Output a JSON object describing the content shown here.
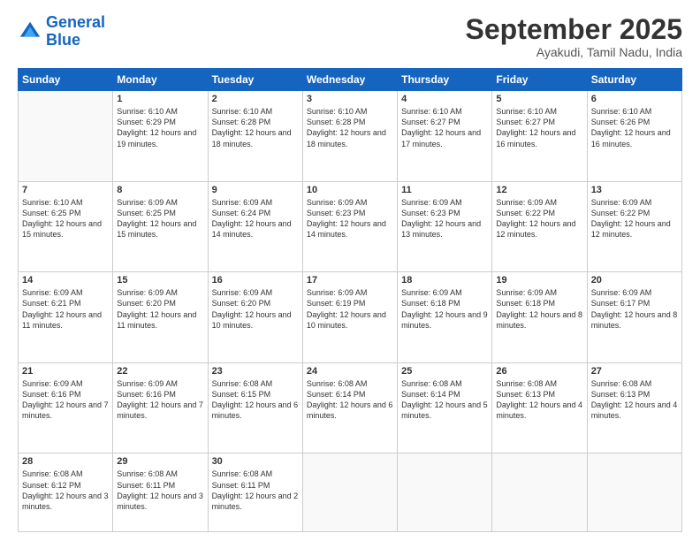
{
  "logo": {
    "line1": "General",
    "line2": "Blue"
  },
  "title": "September 2025",
  "location": "Ayakudi, Tamil Nadu, India",
  "days_header": [
    "Sunday",
    "Monday",
    "Tuesday",
    "Wednesday",
    "Thursday",
    "Friday",
    "Saturday"
  ],
  "weeks": [
    [
      {
        "num": "",
        "sunrise": "",
        "sunset": "",
        "daylight": ""
      },
      {
        "num": "1",
        "sunrise": "Sunrise: 6:10 AM",
        "sunset": "Sunset: 6:29 PM",
        "daylight": "Daylight: 12 hours and 19 minutes."
      },
      {
        "num": "2",
        "sunrise": "Sunrise: 6:10 AM",
        "sunset": "Sunset: 6:28 PM",
        "daylight": "Daylight: 12 hours and 18 minutes."
      },
      {
        "num": "3",
        "sunrise": "Sunrise: 6:10 AM",
        "sunset": "Sunset: 6:28 PM",
        "daylight": "Daylight: 12 hours and 18 minutes."
      },
      {
        "num": "4",
        "sunrise": "Sunrise: 6:10 AM",
        "sunset": "Sunset: 6:27 PM",
        "daylight": "Daylight: 12 hours and 17 minutes."
      },
      {
        "num": "5",
        "sunrise": "Sunrise: 6:10 AM",
        "sunset": "Sunset: 6:27 PM",
        "daylight": "Daylight: 12 hours and 16 minutes."
      },
      {
        "num": "6",
        "sunrise": "Sunrise: 6:10 AM",
        "sunset": "Sunset: 6:26 PM",
        "daylight": "Daylight: 12 hours and 16 minutes."
      }
    ],
    [
      {
        "num": "7",
        "sunrise": "Sunrise: 6:10 AM",
        "sunset": "Sunset: 6:25 PM",
        "daylight": "Daylight: 12 hours and 15 minutes."
      },
      {
        "num": "8",
        "sunrise": "Sunrise: 6:09 AM",
        "sunset": "Sunset: 6:25 PM",
        "daylight": "Daylight: 12 hours and 15 minutes."
      },
      {
        "num": "9",
        "sunrise": "Sunrise: 6:09 AM",
        "sunset": "Sunset: 6:24 PM",
        "daylight": "Daylight: 12 hours and 14 minutes."
      },
      {
        "num": "10",
        "sunrise": "Sunrise: 6:09 AM",
        "sunset": "Sunset: 6:23 PM",
        "daylight": "Daylight: 12 hours and 14 minutes."
      },
      {
        "num": "11",
        "sunrise": "Sunrise: 6:09 AM",
        "sunset": "Sunset: 6:23 PM",
        "daylight": "Daylight: 12 hours and 13 minutes."
      },
      {
        "num": "12",
        "sunrise": "Sunrise: 6:09 AM",
        "sunset": "Sunset: 6:22 PM",
        "daylight": "Daylight: 12 hours and 12 minutes."
      },
      {
        "num": "13",
        "sunrise": "Sunrise: 6:09 AM",
        "sunset": "Sunset: 6:22 PM",
        "daylight": "Daylight: 12 hours and 12 minutes."
      }
    ],
    [
      {
        "num": "14",
        "sunrise": "Sunrise: 6:09 AM",
        "sunset": "Sunset: 6:21 PM",
        "daylight": "Daylight: 12 hours and 11 minutes."
      },
      {
        "num": "15",
        "sunrise": "Sunrise: 6:09 AM",
        "sunset": "Sunset: 6:20 PM",
        "daylight": "Daylight: 12 hours and 11 minutes."
      },
      {
        "num": "16",
        "sunrise": "Sunrise: 6:09 AM",
        "sunset": "Sunset: 6:20 PM",
        "daylight": "Daylight: 12 hours and 10 minutes."
      },
      {
        "num": "17",
        "sunrise": "Sunrise: 6:09 AM",
        "sunset": "Sunset: 6:19 PM",
        "daylight": "Daylight: 12 hours and 10 minutes."
      },
      {
        "num": "18",
        "sunrise": "Sunrise: 6:09 AM",
        "sunset": "Sunset: 6:18 PM",
        "daylight": "Daylight: 12 hours and 9 minutes."
      },
      {
        "num": "19",
        "sunrise": "Sunrise: 6:09 AM",
        "sunset": "Sunset: 6:18 PM",
        "daylight": "Daylight: 12 hours and 8 minutes."
      },
      {
        "num": "20",
        "sunrise": "Sunrise: 6:09 AM",
        "sunset": "Sunset: 6:17 PM",
        "daylight": "Daylight: 12 hours and 8 minutes."
      }
    ],
    [
      {
        "num": "21",
        "sunrise": "Sunrise: 6:09 AM",
        "sunset": "Sunset: 6:16 PM",
        "daylight": "Daylight: 12 hours and 7 minutes."
      },
      {
        "num": "22",
        "sunrise": "Sunrise: 6:09 AM",
        "sunset": "Sunset: 6:16 PM",
        "daylight": "Daylight: 12 hours and 7 minutes."
      },
      {
        "num": "23",
        "sunrise": "Sunrise: 6:08 AM",
        "sunset": "Sunset: 6:15 PM",
        "daylight": "Daylight: 12 hours and 6 minutes."
      },
      {
        "num": "24",
        "sunrise": "Sunrise: 6:08 AM",
        "sunset": "Sunset: 6:14 PM",
        "daylight": "Daylight: 12 hours and 6 minutes."
      },
      {
        "num": "25",
        "sunrise": "Sunrise: 6:08 AM",
        "sunset": "Sunset: 6:14 PM",
        "daylight": "Daylight: 12 hours and 5 minutes."
      },
      {
        "num": "26",
        "sunrise": "Sunrise: 6:08 AM",
        "sunset": "Sunset: 6:13 PM",
        "daylight": "Daylight: 12 hours and 4 minutes."
      },
      {
        "num": "27",
        "sunrise": "Sunrise: 6:08 AM",
        "sunset": "Sunset: 6:13 PM",
        "daylight": "Daylight: 12 hours and 4 minutes."
      }
    ],
    [
      {
        "num": "28",
        "sunrise": "Sunrise: 6:08 AM",
        "sunset": "Sunset: 6:12 PM",
        "daylight": "Daylight: 12 hours and 3 minutes."
      },
      {
        "num": "29",
        "sunrise": "Sunrise: 6:08 AM",
        "sunset": "Sunset: 6:11 PM",
        "daylight": "Daylight: 12 hours and 3 minutes."
      },
      {
        "num": "30",
        "sunrise": "Sunrise: 6:08 AM",
        "sunset": "Sunset: 6:11 PM",
        "daylight": "Daylight: 12 hours and 2 minutes."
      },
      {
        "num": "",
        "sunrise": "",
        "sunset": "",
        "daylight": ""
      },
      {
        "num": "",
        "sunrise": "",
        "sunset": "",
        "daylight": ""
      },
      {
        "num": "",
        "sunrise": "",
        "sunset": "",
        "daylight": ""
      },
      {
        "num": "",
        "sunrise": "",
        "sunset": "",
        "daylight": ""
      }
    ]
  ]
}
